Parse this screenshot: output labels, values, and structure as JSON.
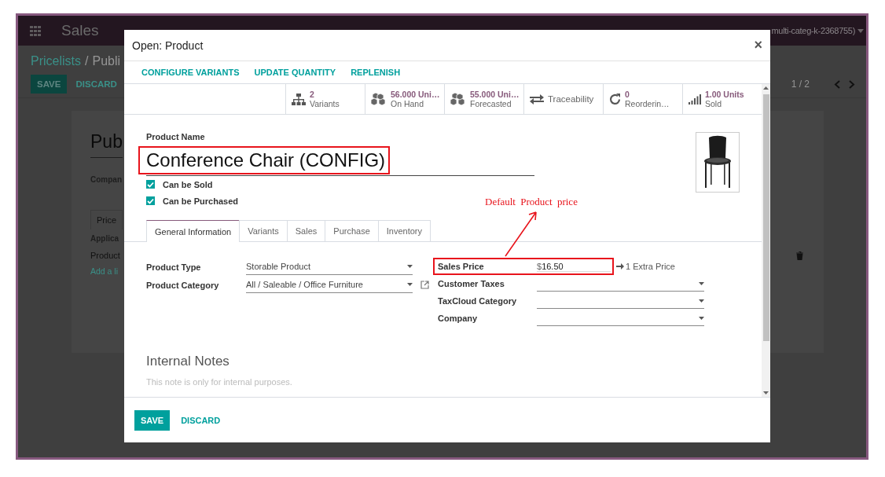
{
  "background": {
    "app_name": "Sales",
    "user_menu": "multi-categ-k-2368755)",
    "breadcrumb_parent": "Pricelists",
    "breadcrumb_separator": "/",
    "breadcrumb_current": "Publi",
    "save": "SAVE",
    "discard": "DISCARD",
    "pager": "1 / 2",
    "record_title": "Pub",
    "company_label": "Compan",
    "tab": "Price",
    "column": "Applica",
    "row": "Product",
    "add_line": "Add a li"
  },
  "dialog": {
    "title": "Open: Product",
    "close": "×",
    "actions": [
      "CONFIGURE VARIANTS",
      "UPDATE QUANTITY",
      "REPLENISH"
    ],
    "stat_buttons": [
      {
        "value": "2",
        "label": "Variants"
      },
      {
        "value": "56.000 Uni…",
        "label": "On Hand"
      },
      {
        "value": "55.000 Uni…",
        "label": "Forecasted"
      },
      {
        "label": "Traceability"
      },
      {
        "value": "0",
        "label": "Reorderin…"
      },
      {
        "value": "1.00 Units",
        "label": "Sold"
      }
    ],
    "product_name_label": "Product Name",
    "product_name": {
      "text": "Conference Chair (CONFIG)",
      "highlighted": true
    },
    "checkboxes": [
      {
        "label": "Can be Sold",
        "checked": true
      },
      {
        "label": "Can be Purchased",
        "checked": true
      }
    ],
    "tabs": [
      {
        "label": "General Information",
        "selected": true
      },
      {
        "label": "Variants",
        "selected": false
      },
      {
        "label": "Sales",
        "selected": false
      },
      {
        "label": "Purchase",
        "selected": false
      },
      {
        "label": "Inventory",
        "selected": false
      }
    ],
    "left_fields": [
      {
        "label": "Product Type",
        "value": "Storable Product",
        "kind": "select",
        "external_link": false
      },
      {
        "label": "Product Category",
        "value": "All / Saleable / Office Furniture",
        "kind": "select",
        "external_link": true
      }
    ],
    "right_fields": [
      {
        "label": "Sales Price",
        "kind": "price",
        "currency": "$",
        "value": "16.50",
        "highlighted": true,
        "extra": "1 Extra Price"
      },
      {
        "label": "Customer Taxes",
        "kind": "select"
      },
      {
        "label": "TaxCloud Category",
        "kind": "select"
      },
      {
        "label": "Company",
        "kind": "select"
      }
    ],
    "notes_title": "Internal Notes",
    "notes_placeholder": "This note is only for internal purposes.",
    "footer_buttons": [
      "SAVE",
      "DISCARD"
    ],
    "annotation": "Default Product price"
  }
}
